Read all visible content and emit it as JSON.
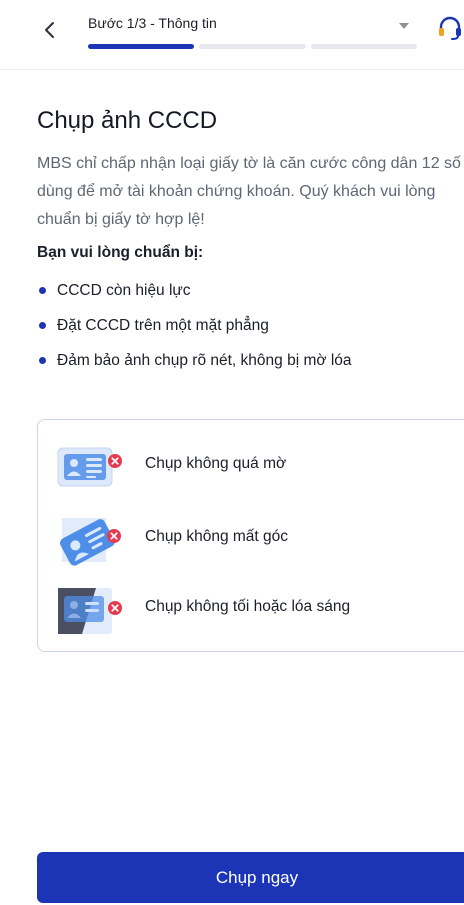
{
  "header": {
    "step_label": "Bước 1/3 - Thông tin",
    "progress_steps_total": 3,
    "progress_step_current": 1
  },
  "main": {
    "title": "Chụp ảnh CCCD",
    "description": "MBS chỉ chấp nhận loại giấy tờ là căn cước công dân 12 số dùng để mở tài khoản chứng khoán. Quý khách vui lòng chuẩn bị giấy tờ hợp lệ!",
    "prep_title": "Bạn vui lòng chuẩn bị:",
    "bullets": [
      "CCCD còn hiệu lực",
      "Đặt CCCD trên một mặt phẳng",
      "Đảm bảo ảnh chụp rõ nét, không bị mờ lóa"
    ]
  },
  "tips": [
    {
      "label": "Chụp không quá mờ",
      "icon": "blurry-card-icon"
    },
    {
      "label": "Chụp không mất góc",
      "icon": "cropped-card-icon"
    },
    {
      "label": "Chụp không tối hoặc lóa sáng",
      "icon": "dark-glare-card-icon"
    }
  ],
  "cta": {
    "label": "Chụp ngay"
  },
  "colors": {
    "primary": "#1c35b7",
    "error": "#e53950",
    "text_secondary": "#5f6674"
  }
}
